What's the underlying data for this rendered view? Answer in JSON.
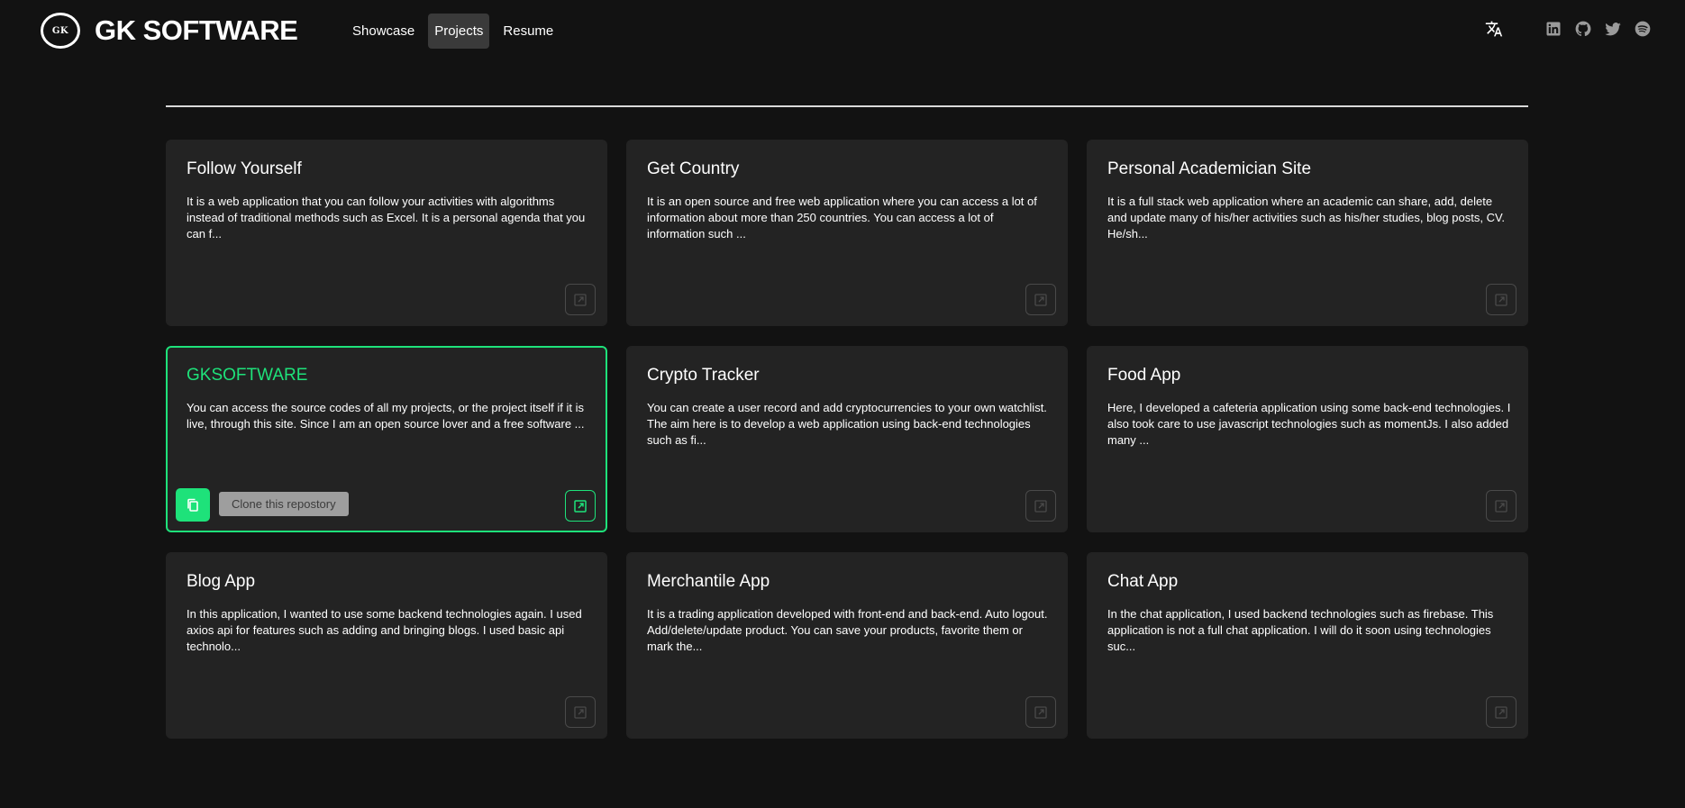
{
  "brand": {
    "logo_text": "GK",
    "name": "GK SOFTWARE"
  },
  "nav": {
    "items": [
      {
        "label": "Showcase",
        "active": false
      },
      {
        "label": "Projects",
        "active": true
      },
      {
        "label": "Resume",
        "active": false
      }
    ]
  },
  "header_icons": {
    "translate": "translate-icon",
    "socials": [
      "linkedin-icon",
      "github-icon",
      "twitter-icon",
      "spotify-icon"
    ]
  },
  "colors": {
    "background": "#121212",
    "card": "#232323",
    "accent": "#1ee27a"
  },
  "projects": [
    {
      "title": "Follow Yourself",
      "description": "It is a web application that you can follow your activities with algorithms instead of traditional methods such as Excel. It is a personal agenda that you can f..."
    },
    {
      "title": "Get Country",
      "description": "It is an open source and free web application where you can access a lot of information about more than 250 countries. You can access a lot of information such ..."
    },
    {
      "title": "Personal Academician Site",
      "description": "It is a full stack web application where an academic can share, add, delete and update many of his/her activities such as his/her studies, blog posts, CV. He/sh..."
    },
    {
      "title": "GKSOFTWARE",
      "description": "You can access the source codes of all my projects, or the project itself if it is live, through this site. Since I am an open source lover and a free software ...",
      "clone_label": "Clone this repostory"
    },
    {
      "title": "Crypto Tracker",
      "description": "You can create a user record and add cryptocurrencies to your own watchlist. The aim here is to develop a web application using back-end technologies such as fi..."
    },
    {
      "title": "Food App",
      "description": "Here, I developed a cafeteria application using some back-end technologies. I also took care to use javascript technologies such as momentJs. I also added many ..."
    },
    {
      "title": "Blog App",
      "description": "In this application, I wanted to use some backend technologies again. I used axios api for features such as adding and bringing blogs. I used basic api technolo..."
    },
    {
      "title": "Merchantile App",
      "description": "It is a trading application developed with front-end and back-end. Auto logout. Add/delete/update product. You can save your products, favorite them or mark the..."
    },
    {
      "title": "Chat App",
      "description": "In the chat application, I used backend technologies such as firebase. This application is not a full chat application. I will do it soon using technologies suc..."
    }
  ]
}
